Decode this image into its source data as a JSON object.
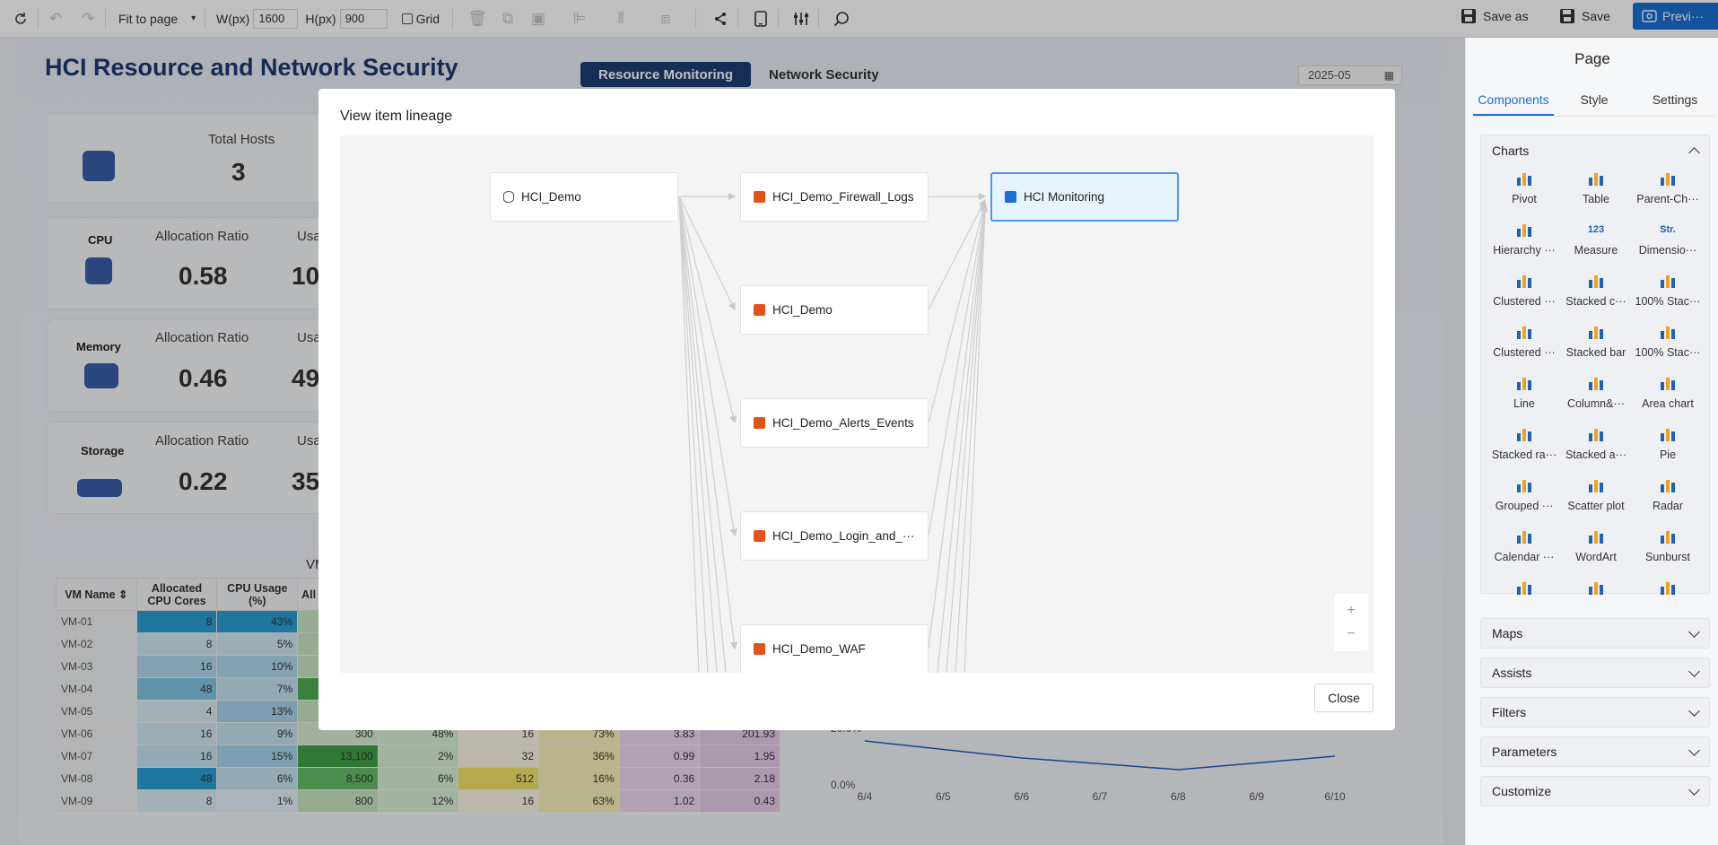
{
  "toolbar": {
    "fit_label": "Fit to page",
    "width_label": "W(px)",
    "width_value": "1600",
    "height_label": "H(px)",
    "height_value": "900",
    "grid_label": "Grid",
    "save_as_label": "Save as",
    "save_label": "Save",
    "preview_label": "Previ···"
  },
  "dashboard": {
    "title": "HCI Resource and Network Security",
    "tabs": [
      "Resource Monitoring",
      "Network Security"
    ],
    "date": "2025-05",
    "total_hosts_label": "Total Hosts",
    "total_hosts_value": "3",
    "cpu": {
      "label": "CPU",
      "alloc_label": "Allocation Ratio",
      "alloc_value": "0.58",
      "usage_label": "Usa",
      "usage_value": "10"
    },
    "memory": {
      "label": "Memory",
      "alloc_label": "Allocation Ratio",
      "alloc_value": "0.46",
      "usage_label": "Usa",
      "usage_value": "49"
    },
    "storage": {
      "label": "Storage",
      "alloc_label": "Allocation Ratio",
      "alloc_value": "0.22",
      "usage_label": "Usa",
      "usage_value": "35"
    },
    "table_title_fragment": "VM",
    "table": {
      "headers": [
        "VM Name",
        "Allocated CPU Cores",
        "CPU Usage (%)",
        "All"
      ],
      "rows": [
        [
          "VM-01",
          "8",
          "43%",
          "",
          "",
          "",
          "",
          "",
          ""
        ],
        [
          "VM-02",
          "8",
          "5%",
          "",
          "",
          "",
          "",
          "",
          ""
        ],
        [
          "VM-03",
          "16",
          "10%",
          "",
          "",
          "",
          "",
          "",
          ""
        ],
        [
          "VM-04",
          "48",
          "7%",
          "",
          "",
          "",
          "",
          "",
          ""
        ],
        [
          "VM-05",
          "4",
          "13%",
          "",
          "",
          "",
          "",
          "",
          ""
        ],
        [
          "VM-06",
          "16",
          "9%",
          "300",
          "48%",
          "16",
          "73%",
          "3.83",
          "201.93"
        ],
        [
          "VM-07",
          "16",
          "15%",
          "13,100",
          "2%",
          "32",
          "36%",
          "0.99",
          "1.95"
        ],
        [
          "VM-08",
          "48",
          "6%",
          "8,500",
          "6%",
          "512",
          "16%",
          "0.36",
          "2.18"
        ],
        [
          "VM-09",
          "8",
          "1%",
          "800",
          "12%",
          "16",
          "63%",
          "1.02",
          "0.43"
        ]
      ]
    },
    "line_chart": {
      "y_ticks": [
        "20.0%",
        "0.0%"
      ],
      "x_ticks": [
        "6/4",
        "6/5",
        "6/6",
        "6/7",
        "6/8",
        "6/9",
        "6/10"
      ]
    }
  },
  "modal": {
    "title": "View item lineage",
    "nodes": {
      "source": "HCI_Demo",
      "datasets": [
        "HCI_Demo_Firewall_Logs",
        "HCI_Demo",
        "HCI_Demo_Alerts_Events",
        "HCI_Demo_Login_and_···",
        "HCI_Demo_WAF"
      ],
      "report": "HCI Monitoring"
    },
    "zoom_in": "+",
    "zoom_out": "−",
    "close_label": "Close"
  },
  "right_panel": {
    "title": "Page",
    "tabs": [
      "Components",
      "Style",
      "Settings"
    ],
    "charts_label": "Charts",
    "chart_items": [
      {
        "label": "Pivot",
        "icon": "pivot-icon"
      },
      {
        "label": "Table",
        "icon": "table-icon"
      },
      {
        "label": "Parent-Ch···",
        "icon": "parent-child-icon"
      },
      {
        "label": "Hierarchy ···",
        "icon": "hierarchy-icon"
      },
      {
        "label": "Measure",
        "icon": "measure-icon",
        "glyph": "123"
      },
      {
        "label": "Dimensio···",
        "icon": "dimension-icon",
        "glyph": "Str."
      },
      {
        "label": "Clustered ···",
        "icon": "clustered-column-icon"
      },
      {
        "label": "Stacked c···",
        "icon": "stacked-column-icon"
      },
      {
        "label": "100% Stac···",
        "icon": "percent-stacked-column-icon"
      },
      {
        "label": "Clustered ···",
        "icon": "clustered-bar-icon"
      },
      {
        "label": "Stacked bar",
        "icon": "stacked-bar-icon"
      },
      {
        "label": "100% Stac···",
        "icon": "percent-stacked-bar-icon"
      },
      {
        "label": "Line",
        "icon": "line-chart-icon"
      },
      {
        "label": "Column&···",
        "icon": "column-line-icon"
      },
      {
        "label": "Area chart",
        "icon": "area-chart-icon"
      },
      {
        "label": "Stacked ra···",
        "icon": "stacked-range-icon"
      },
      {
        "label": "Stacked a···",
        "icon": "stacked-area-icon"
      },
      {
        "label": "Pie",
        "icon": "pie-icon"
      },
      {
        "label": "Grouped ···",
        "icon": "grouped-donut-icon"
      },
      {
        "label": "Scatter plot",
        "icon": "scatter-icon"
      },
      {
        "label": "Radar",
        "icon": "radar-icon"
      },
      {
        "label": "Calendar ···",
        "icon": "calendar-heatmap-icon"
      },
      {
        "label": "WordArt",
        "icon": "wordart-icon"
      },
      {
        "label": "Sunburst",
        "icon": "sunburst-icon"
      },
      {
        "label": "",
        "icon": "gauge-icon"
      },
      {
        "label": "",
        "icon": "funnel-icon"
      },
      {
        "label": "",
        "icon": "sankey-icon"
      }
    ],
    "sections": [
      "Maps",
      "Assists",
      "Filters",
      "Parameters",
      "Customize"
    ]
  }
}
